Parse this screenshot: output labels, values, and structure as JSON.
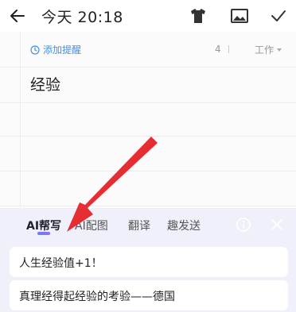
{
  "header": {
    "title": "今天 20:18",
    "icons": [
      "back-arrow-icon",
      "shirt-icon",
      "image-icon",
      "checkmark-icon"
    ]
  },
  "note": {
    "reminder_label": "添加提醒",
    "char_count": "4",
    "category": "工作",
    "body_text": "经验"
  },
  "ai_panel": {
    "tabs": [
      {
        "label": "AI帮写",
        "active": true
      },
      {
        "label": "AI配图",
        "active": false
      },
      {
        "label": "翻译",
        "active": false
      },
      {
        "label": "趣发送",
        "active": false
      }
    ],
    "suggestions": [
      "人生经验值+1！",
      "真理经得起经验的考验——德国"
    ]
  },
  "colors": {
    "accent": "#4a8ee0",
    "panel_bg": "#eff0f9",
    "arrow": "#e8262b"
  }
}
